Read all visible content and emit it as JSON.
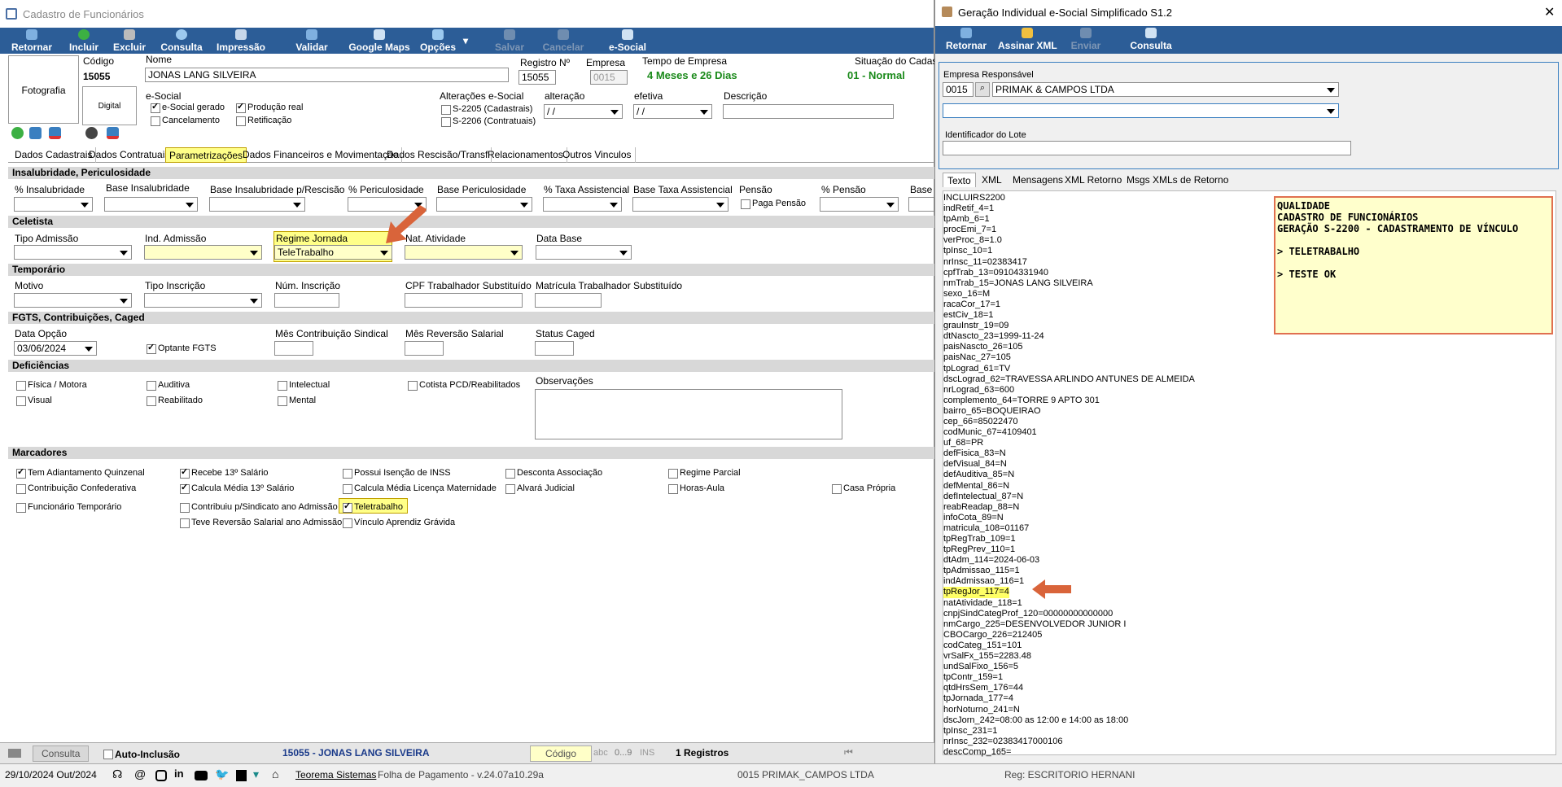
{
  "main": {
    "title": "Cadastro de Funcionários",
    "toolbar": [
      "Retornar",
      "Incluir",
      "Excluir",
      "Consulta",
      "Impressão",
      "Validar",
      "Google Maps",
      "Opções",
      "Salvar",
      "Cancelar",
      "e-Social"
    ],
    "photo": "Fotografia",
    "digital": "Digital",
    "codigo_label": "Código",
    "codigo": "15055",
    "nome_label": "Nome",
    "nome": "JONAS LANG SILVEIRA",
    "registro_label": "Registro Nº",
    "registro": "15055",
    "empresa_label": "Empresa",
    "empresa": "0015",
    "tempo_label": "Tempo de Empresa",
    "tempo": "4 Meses  e 26 Dias",
    "situacao_label": "Situação do Cadas",
    "situacao": "01 - Normal",
    "esocial_label": "e-Social",
    "cb_esocial": "e-Social gerado",
    "cb_producao": "Produção real",
    "cb_cancel": "Cancelamento",
    "cb_retif": "Retificação",
    "alter_label": "Alterações e-Social",
    "s2205": "S-2205 (Cadastrais)",
    "s2206": "S-2206 (Contratuais)",
    "alteracao_label": "alteração",
    "efetiva_label": "efetiva",
    "descricao_label": "Descrição",
    "date_empty": " / /",
    "tabs": [
      "Dados Cadastrais",
      "Dados Contratuais",
      "Parametrizações",
      "Dados Financeiros e Movimentação",
      "Dados Rescisão/Transf",
      "Relacionamentos",
      "Outros Vinculos"
    ],
    "sec_insal": "Insalubridade, Periculosidade",
    "insal_labels": [
      "% Insalubridade",
      "Base Insalubridade",
      "Base Insalubridade p/Rescisão",
      "% Periculosidade",
      "Base Periculosidade",
      "% Taxa Assistencial",
      "Base Taxa Assistencial",
      "Pensão",
      "% Pensão",
      "Base"
    ],
    "paga_pensao": "Paga Pensão",
    "sec_celetista": "Celetista",
    "tipo_admissao": "Tipo Admissão",
    "ind_admissao": "Ind. Admissão",
    "regime_jornada": "Regime Jornada",
    "regime_value": "TeleTrabalho",
    "nat_atividade": "Nat. Atividade",
    "data_base": "Data Base",
    "sec_temporario": "Temporário",
    "motivo": "Motivo",
    "tipo_inscricao": "Tipo Inscrição",
    "num_inscricao": "Núm. Inscrição",
    "cpf_sub": "CPF Trabalhador Substituído",
    "matricula_sub": "Matrícula Trabalhador Substituído",
    "sec_fgts": "FGTS, Contribuições, Caged",
    "data_opcao": "Data Opção",
    "data_opcao_value": "03/06/2024",
    "optante": "Optante FGTS",
    "mes_contrib": "Mês Contribuição Sindical",
    "mes_reversao": "Mês Reversão Salarial",
    "status_caged": "Status Caged",
    "sec_defic": "Deficiências",
    "defic": [
      "Física / Motora",
      "Auditiva",
      "Intelectual",
      "Cotista PCD/Reabilitados",
      "Visual",
      "Reabilitado",
      "Mental"
    ],
    "observacoes": "Observações",
    "sec_marc": "Marcadores",
    "marc": [
      "Tem Adiantamento Quinzenal",
      "Recebe 13º Salário",
      "Possui Isenção de INSS",
      "Desconta Associação",
      "Regime Parcial",
      "Contribuição Confederativa",
      "Calcula Média 13º Salário",
      "Calcula Média Licença Maternidade",
      "Alvará Judicial",
      "Horas-Aula",
      "Casa Própria",
      "Funcionário Temporário",
      "Contribuiu p/Sindicato ano Admissão",
      "Teletrabalho",
      "Teve Reversão Salarial ano Admissão",
      "Vínculo Aprendiz Grávida"
    ],
    "status": {
      "consulta": "Consulta",
      "auto": "Auto-Inclusão",
      "record": "15055 - JONAS LANG SILVEIRA",
      "codigo": "Código",
      "abc": "abc",
      "num": "0...9",
      "ins": "INS",
      "registros": "1 Registros"
    }
  },
  "bottom": {
    "date": "29/10/2024 Out/2024",
    "teorema": "Teorema Sistemas",
    "folha": "Folha de Pagamento - v.24.07a10.29a",
    "empresa": "0015 PRIMAK_CAMPOS LTDA",
    "reg": "Reg: ESCRITORIO HERNANI"
  },
  "side": {
    "title": "Geração Individual e-Social Simplificado S1.2",
    "close": "✕",
    "toolbar": [
      "Retornar",
      "Assinar XML",
      "Enviar",
      "Consulta"
    ],
    "empresa_label": "Empresa Responsável",
    "empresa_code": "0015",
    "empresa_name": "PRIMAK & CAMPOS LTDA",
    "lote_label": "Identificador do Lote",
    "tabs": [
      "Texto",
      "XML",
      "Mensagens",
      "XML Retorno",
      "Msgs XMLs de Retorno"
    ],
    "lines": [
      "INCLUIRS2200",
      "indRetif_4=1",
      "tpAmb_6=1",
      "procEmi_7=1",
      "verProc_8=1.0",
      "tpInsc_10=1",
      "nrInsc_11=02383417",
      "cpfTrab_13=09104331940",
      "nmTrab_15=JONAS LANG SILVEIRA",
      "sexo_16=M",
      "racaCor_17=1",
      "estCiv_18=1",
      "grauInstr_19=09",
      "dtNascto_23=1999-11-24",
      "paisNascto_26=105",
      "paisNac_27=105",
      "tpLograd_61=TV",
      "dscLograd_62=TRAVESSA ARLINDO ANTUNES DE ALMEIDA",
      "nrLograd_63=600",
      "complemento_64=TORRE 9 APTO 301",
      "bairro_65=BOQUEIRAO",
      "cep_66=85022470",
      "codMunic_67=4109401",
      "uf_68=PR",
      "defFisica_83=N",
      "defVisual_84=N",
      "defAuditiva_85=N",
      "defMental_86=N",
      "defIntelectual_87=N",
      "reabReadap_88=N",
      "infoCota_89=N",
      "matricula_108=01167",
      "tpRegTrab_109=1",
      "tpRegPrev_110=1",
      "dtAdm_114=2024-06-03",
      "tpAdmissao_115=1",
      "indAdmissao_116=1",
      "tpRegJor_117=4",
      "natAtividade_118=1",
      "cnpjSindCategProf_120=00000000000000",
      "nmCargo_225=DESENVOLVEDOR JUNIOR I",
      "CBOCargo_226=212405",
      "codCateg_151=101",
      "vrSalFx_155=2283.48",
      "undSalFixo_156=5",
      "tpContr_159=1",
      "qtdHrsSem_176=44",
      "tpJornada_177=4",
      "horNoturno_241=N",
      "dscJorn_242=08:00 as 12:00 e 14:00 as 18:00",
      "tpInsc_231=1",
      "nrInsc_232=02383417000106",
      "descComp_165="
    ],
    "note": "QUALIDADE\nCADASTRO DE FUNCIONÁRIOS\nGERAÇÃO S-2200 - CADASTRAMENTO DE VÍNCULO\n\n> TELETRABALHO\n\n> TESTE OK"
  },
  "colors": {
    "toolbar": "#2c5d97",
    "green": "#1a8a1a",
    "accent_arrow": "#d9643a",
    "highlight": "#ffff66"
  }
}
